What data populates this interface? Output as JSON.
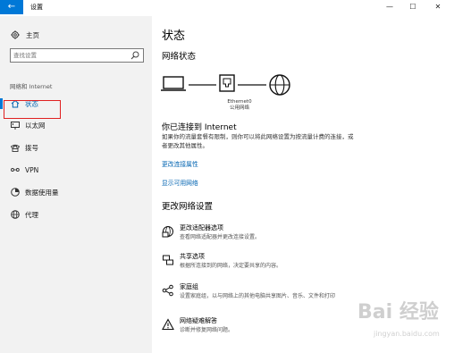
{
  "window": {
    "back_glyph": "←",
    "title": "设置",
    "minimize_glyph": "—",
    "maximize_glyph": "☐",
    "close_glyph": "✕"
  },
  "sidebar": {
    "home_label": "主页",
    "search_placeholder": "查找设置",
    "category": "网络和 Internet",
    "items": [
      {
        "label": "状态",
        "icon": "home-icon",
        "active": true
      },
      {
        "label": "以太网",
        "icon": "ethernet-icon",
        "active": false
      },
      {
        "label": "拨号",
        "icon": "phone-icon",
        "active": false
      },
      {
        "label": "VPN",
        "icon": "vpn-icon",
        "active": false
      },
      {
        "label": "数据使用量",
        "icon": "data-usage-icon",
        "active": false
      },
      {
        "label": "代理",
        "icon": "globe-icon",
        "active": false
      }
    ]
  },
  "main": {
    "title": "状态",
    "network_status_heading": "网络状态",
    "adapter_name": "Ethernet0",
    "network_type": "公用网络",
    "connected_heading": "你已连接到 Internet",
    "connected_desc": "如果你的流量套餐有限制，则你可以将此网络设置为按流量计费的连接，或者更改其他属性。",
    "change_properties_link": "更改连接属性",
    "show_networks_link": "显示可用网络",
    "change_settings_heading": "更改网络设置",
    "options": [
      {
        "title": "更改适配器选项",
        "desc": "查看网络适配器并更改连接设置。",
        "icon": "adapter-icon"
      },
      {
        "title": "共享选项",
        "desc": "根据所连接到的网络，决定要共享的内容。",
        "icon": "sharing-icon"
      },
      {
        "title": "家庭组",
        "desc": "设置家庭组，以与网络上的其他电脑共享图片、音乐、文件和打印",
        "icon": "homegroup-icon"
      },
      {
        "title": "网络疑难解答",
        "desc": "诊断并修复网络问题。",
        "icon": "warning-icon"
      }
    ]
  },
  "colors": {
    "accent": "#0078d7",
    "link": "#0063b1",
    "highlight_box": "#e02020",
    "sidebar_bg": "#f2f2f2"
  },
  "watermark": {
    "text": "Bai 经验",
    "url": "jingyan.baidu.com"
  }
}
